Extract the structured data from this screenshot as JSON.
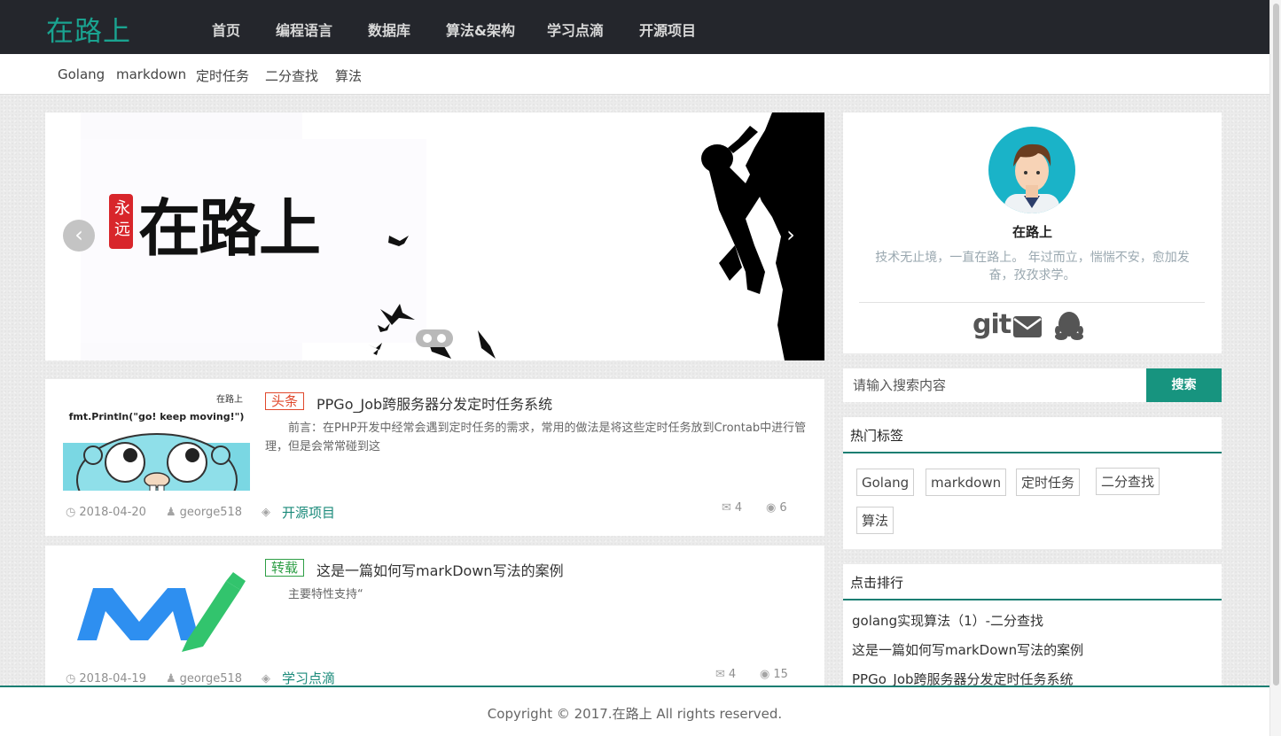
{
  "brand": "在路上",
  "nav": [
    "首页",
    "编程语言",
    "数据库",
    "算法&架构",
    "学习点滴",
    "开源项目"
  ],
  "subnav": [
    "Golang",
    "markdown",
    "定时任务",
    "二分查找",
    "算法"
  ],
  "carousel": {
    "prev": "‹",
    "next": "›",
    "banner_seal": "永远",
    "banner_text": "在路上"
  },
  "articles": [
    {
      "badge": "头条",
      "badge_color": "#e0482c",
      "title": "PPGo_Job跨服务器分发定时任务系统",
      "excerpt": "　　前言：在PHP开发中经常会遇到定时任务的需求，常用的做法是将这些定时任务放到Crontab中进行管理，但是会常常碰到这",
      "date": "2018-04-20",
      "author": "george518",
      "category": "开源项目",
      "comments": "4",
      "views": "6",
      "thumb_text": "fmt.Println(\"go! keep moving!\")",
      "thumb_logo": "在路上"
    },
    {
      "badge": "转载",
      "badge_color": "#2d9e45",
      "title": "这是一篇如何写markDown写法的案例",
      "excerpt": "　　主要特性支持“",
      "date": "2018-04-19",
      "author": "george518",
      "category": "学习点滴",
      "comments": "4",
      "views": "15"
    }
  ],
  "profile": {
    "name": "在路上",
    "bio": "技术无止境，一直在路上。 年过而立，惴惴不安，愈加发奋，孜孜求学。",
    "git": "git"
  },
  "search": {
    "placeholder": "请输入搜索内容",
    "button": "搜索"
  },
  "hot_tags": {
    "title": "热门标签",
    "items": [
      "Golang",
      "markdown",
      "定时任务",
      "二分查找",
      "算法"
    ]
  },
  "ranking": {
    "title": "点击排行",
    "items": [
      "golang实现算法（1）-二分查找",
      "这是一篇如何写markDown写法的案例",
      "PPGo_Job跨服务器分发定时任务系统"
    ]
  },
  "footer": "Copyright © 2017.在路上 All rights reserved.",
  "colors": {
    "accent": "#1aa390",
    "topbar": "#24262c",
    "footer_rule": "#187e72"
  }
}
